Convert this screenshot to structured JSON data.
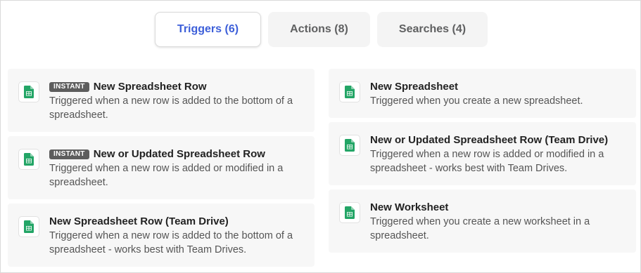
{
  "tabs": [
    {
      "label": "Triggers (6)",
      "active": true
    },
    {
      "label": "Actions (8)",
      "active": false
    },
    {
      "label": "Searches (4)",
      "active": false
    }
  ],
  "accent_color": "#3d5fd9",
  "icon_name": "google-sheets-icon",
  "badge_label": "INSTANT",
  "left_cards": [
    {
      "badge": "INSTANT",
      "title": "New Spreadsheet Row",
      "description": "Triggered when a new row is added to the bottom of a spreadsheet."
    },
    {
      "badge": "INSTANT",
      "title": "New or Updated Spreadsheet Row",
      "description": "Triggered when a new row is added or modified in a spreadsheet."
    },
    {
      "badge": "",
      "title": "New Spreadsheet Row (Team Drive)",
      "description": "Triggered when a new row is added to the bottom of a spreadsheet - works best with Team Drives."
    }
  ],
  "right_cards": [
    {
      "title": "New Spreadsheet",
      "description": "Triggered when you create a new spreadsheet."
    },
    {
      "title": "New or Updated Spreadsheet Row (Team Drive)",
      "description": "Triggered when a new row is added or modified in a spreadsheet - works best with Team Drives."
    },
    {
      "title": "New Worksheet",
      "description": "Triggered when you create a new worksheet in a spreadsheet."
    }
  ]
}
